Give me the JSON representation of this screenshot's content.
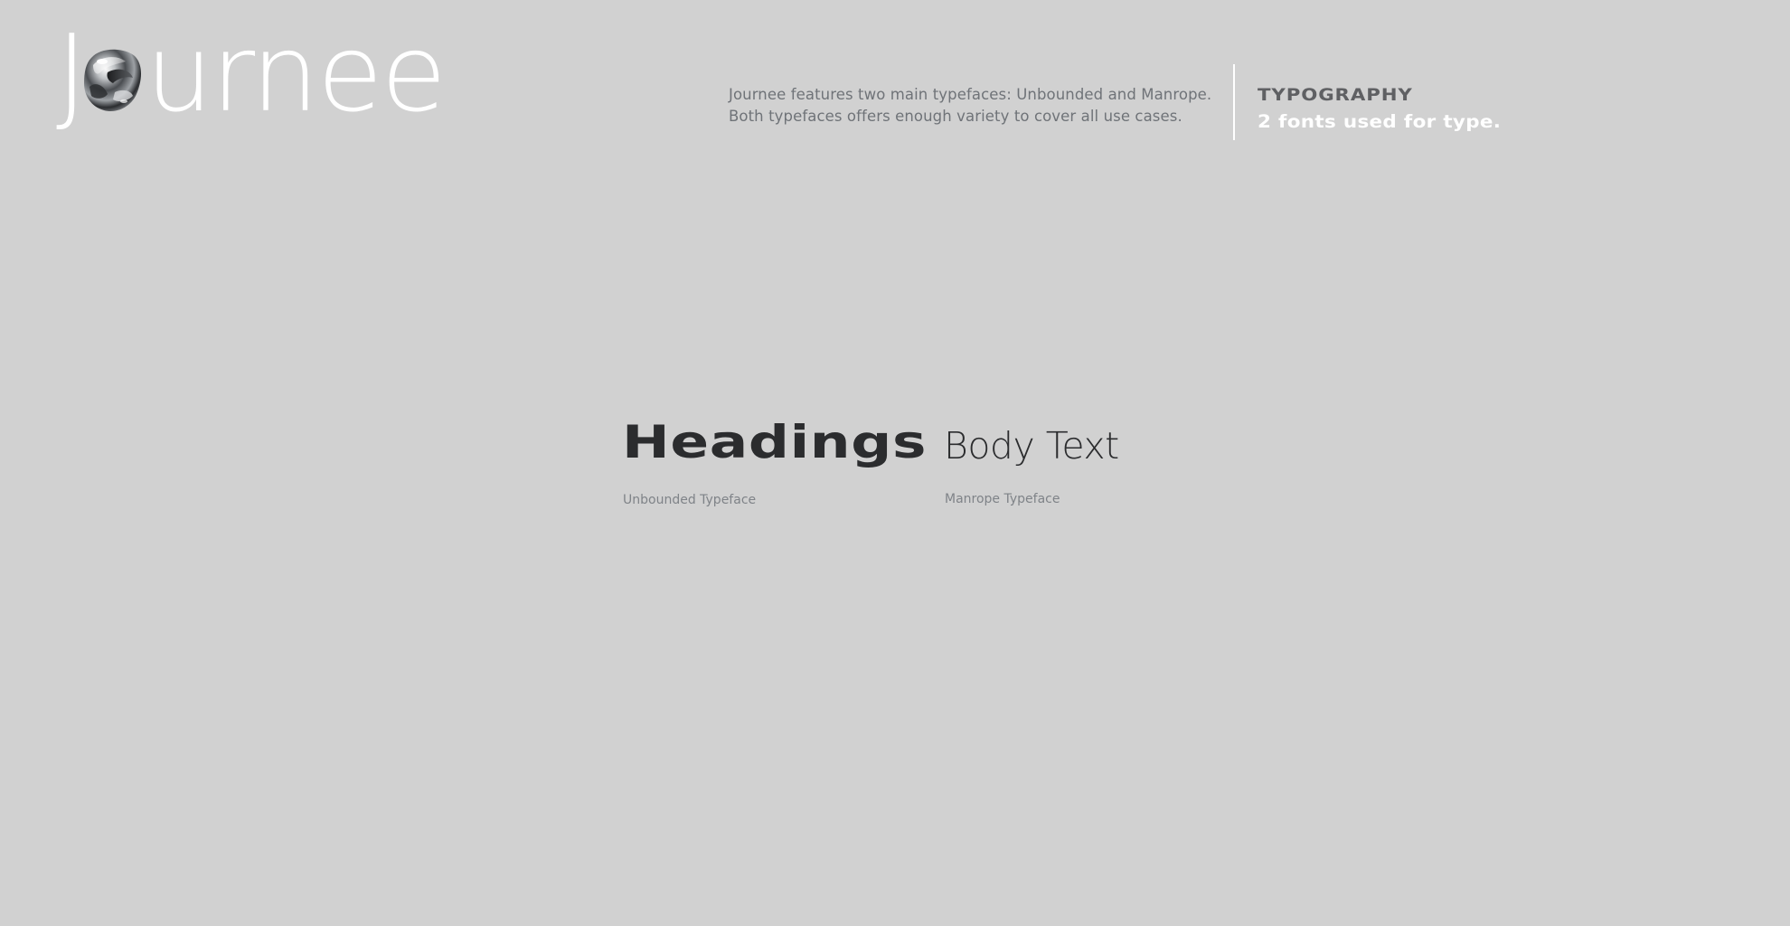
{
  "logo": {
    "prefix": "J",
    "suffix": "urnee",
    "orb_icon": "chrome-blob-icon"
  },
  "header": {
    "description": "Journee features two main typefaces: Unbounded and Manrope. Both typefaces offers enough variety to cover all use cases.",
    "section_label": "TYPOGRAPHY",
    "section_sub": "2 fonts used for type."
  },
  "specimens": {
    "heading": {
      "sample": "Headings",
      "caption": "Unbounded Typeface"
    },
    "body": {
      "sample": "Body Text",
      "caption": "Manrope Typeface"
    }
  },
  "colors": {
    "background": "#d1d1d1",
    "logo": "#ffffff",
    "specimen_text": "#2b2c2e",
    "caption_text": "#7f8388",
    "label_text": "#5f6063",
    "sub_label": "#ffffff"
  }
}
